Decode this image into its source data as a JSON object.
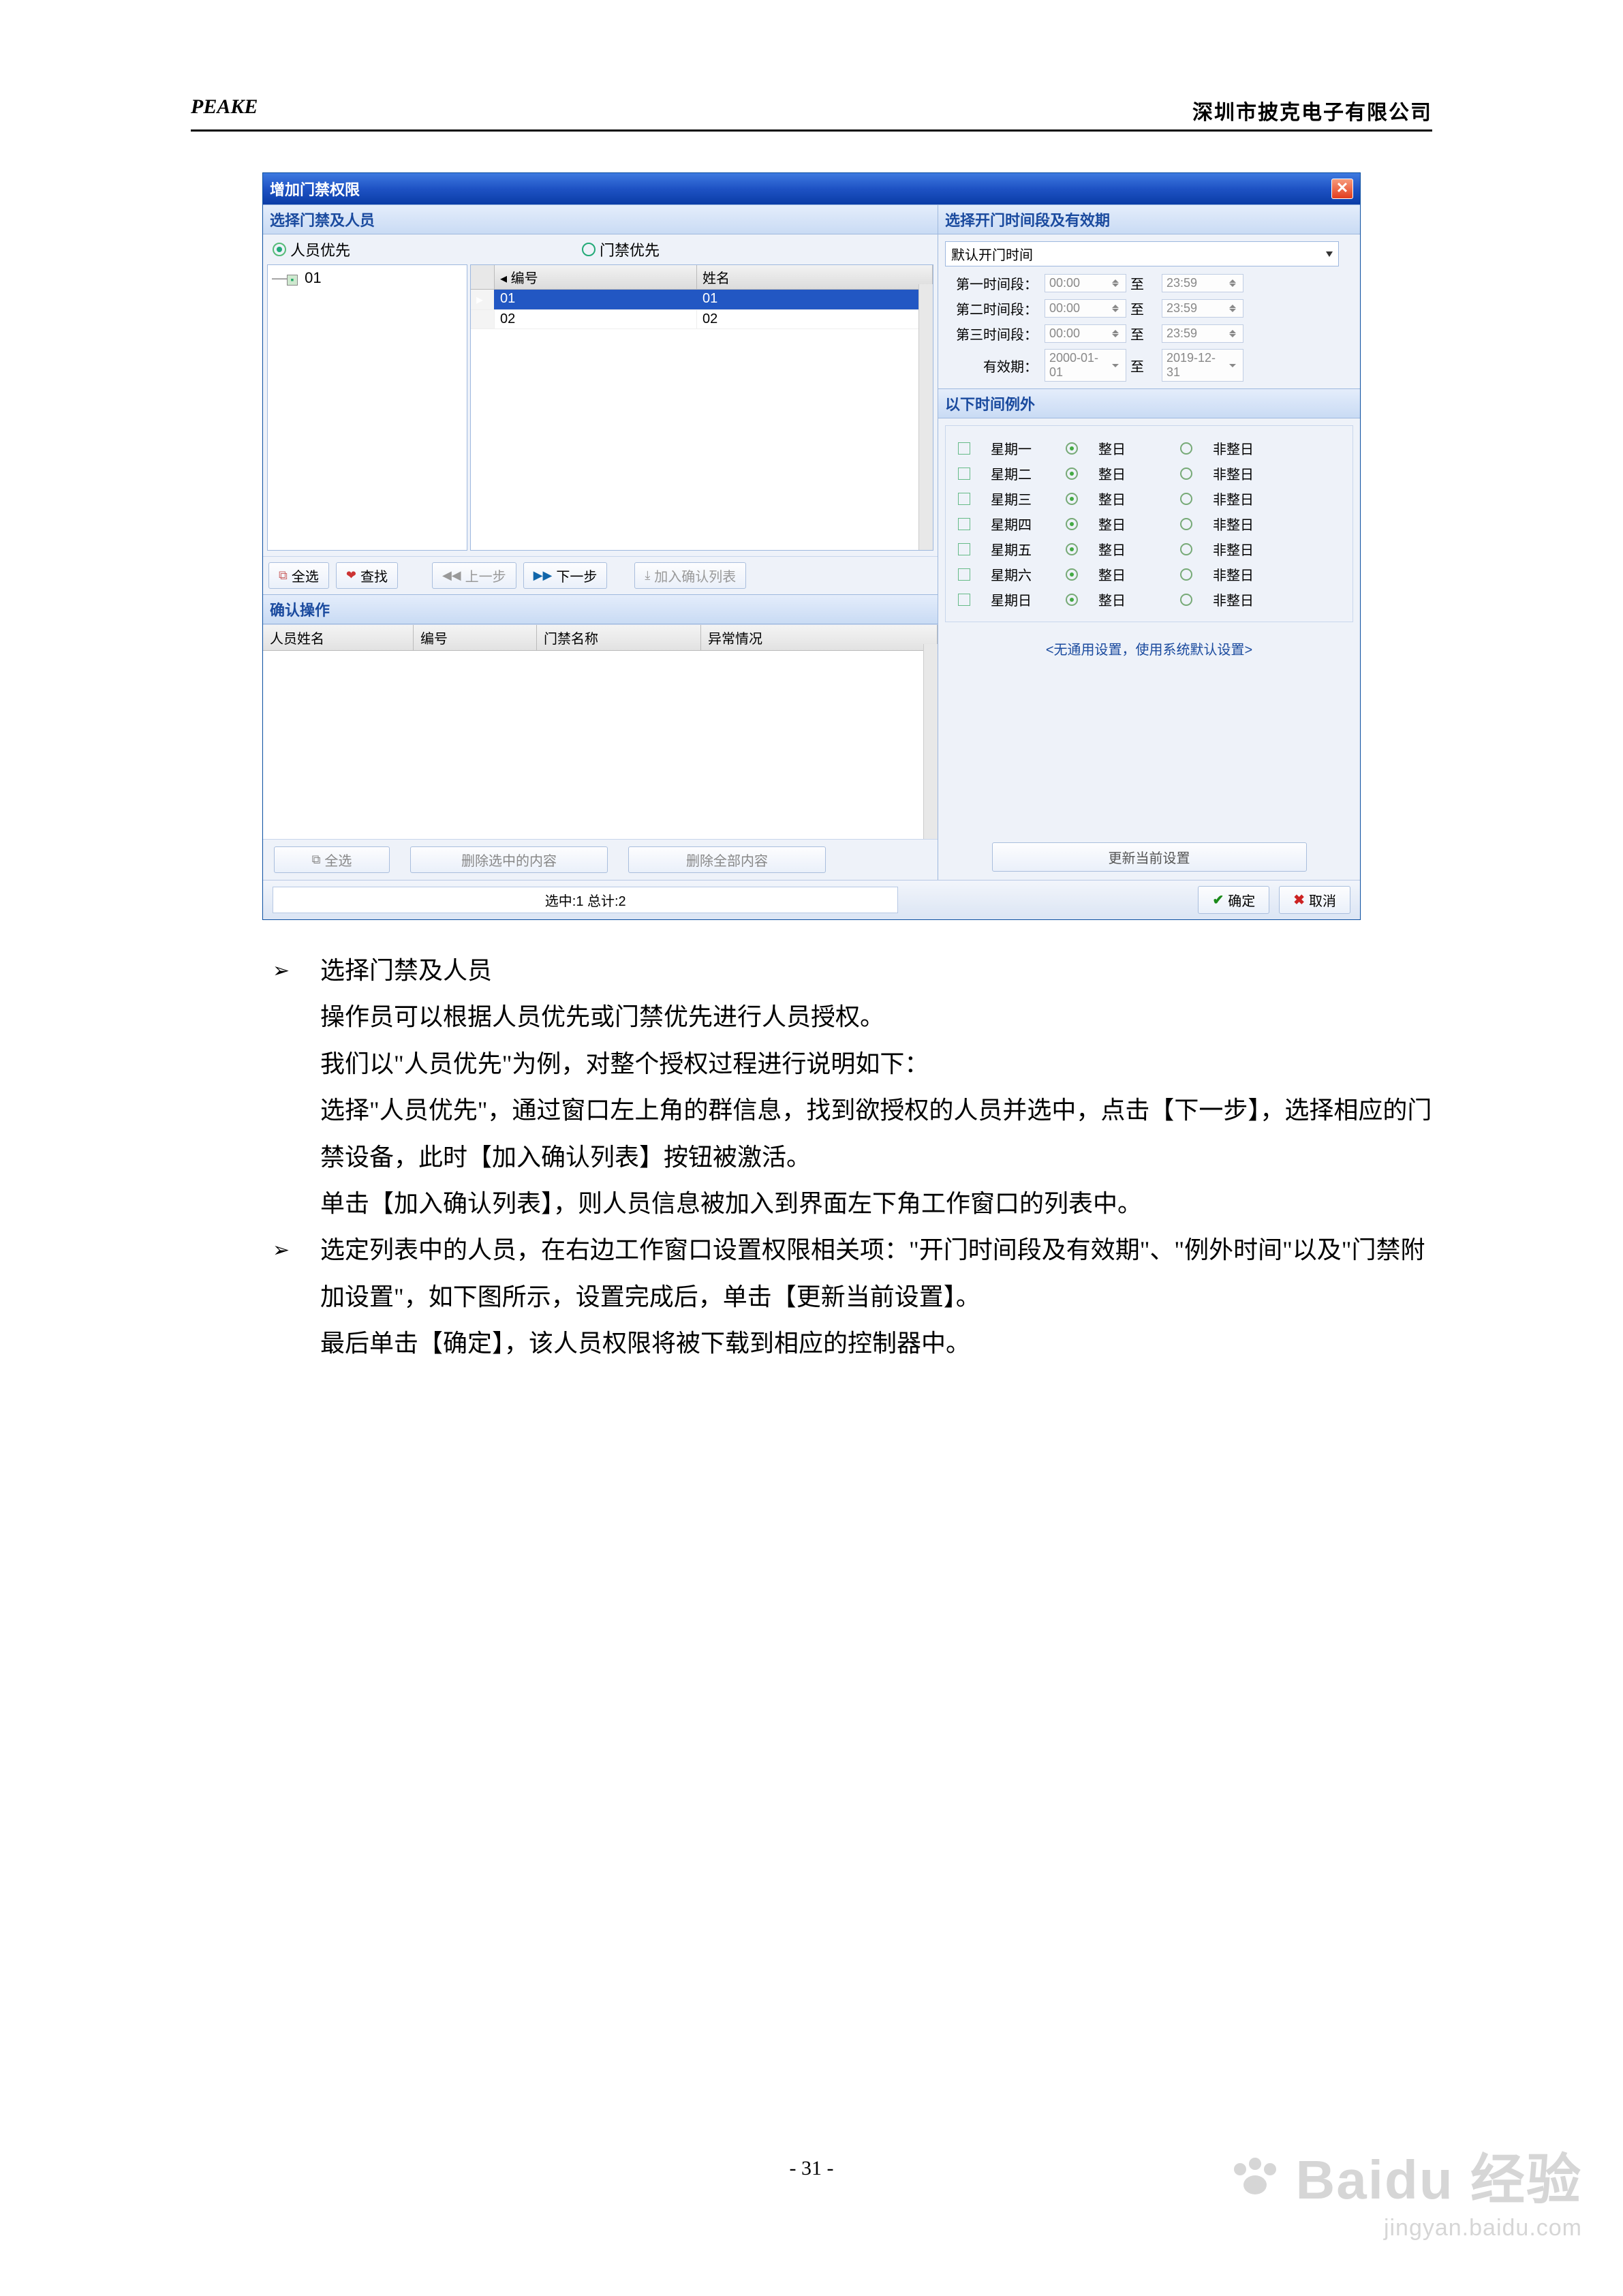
{
  "header": {
    "left": "PEAKE",
    "right": "深圳市披克电子有限公司"
  },
  "dialog": {
    "title": "增加门禁权限",
    "sectionLeft": "选择门禁及人员",
    "sectionRight": "选择开门时间段及有效期",
    "radioPerson": "人员优先",
    "radioDoor": "门禁优先",
    "treeItem": "01",
    "gridHead": {
      "col1": "编号",
      "col2": "姓名"
    },
    "gridRows": [
      {
        "c1": "01",
        "c2": "01"
      },
      {
        "c1": "02",
        "c2": "02"
      }
    ],
    "btns": {
      "selectAll": "全选",
      "find": "查找",
      "prev": "上一步",
      "next": "下一步",
      "addList": "加入确认列表"
    },
    "confirmHdr": "确认操作",
    "confirmCols": {
      "a": "人员姓名",
      "b": "编号",
      "c": "门禁名称",
      "d": "异常情况"
    },
    "midBtn": {
      "sa": "全选",
      "delSel": "删除选中的内容",
      "delAll": "删除全部内容"
    },
    "dropdown": "默认开门时间",
    "timeLabels": {
      "t1": "第一时间段：",
      "t2": "第二时间段：",
      "t3": "第三时间段：",
      "valid": "有效期：",
      "to": "至"
    },
    "timeVals": {
      "start": "00:00",
      "end": "23:59",
      "d1": "2000-01-01",
      "d2": "2019-12-31"
    },
    "exceptHdr": "以下时间例外",
    "days": [
      "星期一",
      "星期二",
      "星期三",
      "星期四",
      "星期五",
      "星期六",
      "星期日"
    ],
    "dayOpts": {
      "full": "整日",
      "notfull": "非整日"
    },
    "note": "<无通用设置，使用系统默认设置>",
    "update": "更新当前设置",
    "status": "选中:1 总计:2",
    "ok": "确定",
    "cancel": "取消"
  },
  "text": {
    "b1_title": "选择门禁及人员",
    "b1_l1": "操作员可以根据人员优先或门禁优先进行人员授权。",
    "b1_l2": "我们以\"人员优先\"为例，对整个授权过程进行说明如下：",
    "b1_l3": "选择\"人员优先\"，通过窗口左上角的群信息，找到欲授权的人员并选中，点击【下一步】，选择相应的门禁设备，此时【加入确认列表】按钮被激活。",
    "b1_l4": "单击【加入确认列表】，则人员信息被加入到界面左下角工作窗口的列表中。",
    "b2_l1": "选定列表中的人员，在右边工作窗口设置权限相关项：\"开门时间段及有效期\"、\"例外时间\"以及\"门禁附加设置\"，如下图所示，设置完成后，单击【更新当前设置】。",
    "b2_l2": "最后单击【确定】，该人员权限将被下载到相应的控制器中。"
  },
  "pageNum": "- 31 -",
  "watermark": {
    "brand": "Baidu",
    "cn": "经验",
    "url": "jingyan.baidu.com"
  }
}
